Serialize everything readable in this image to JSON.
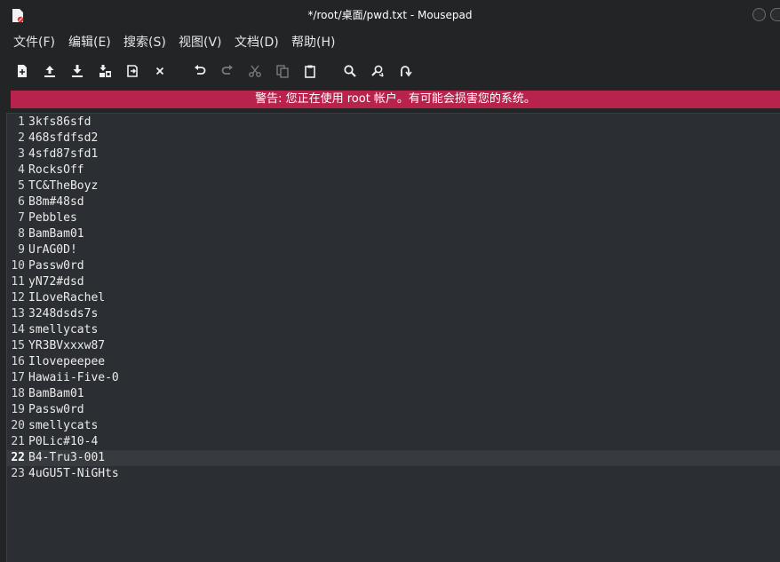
{
  "window": {
    "title": "*/root/桌面/pwd.txt - Mousepad"
  },
  "menu": [
    {
      "label": "文件(F)"
    },
    {
      "label": "编辑(E)"
    },
    {
      "label": "搜索(S)"
    },
    {
      "label": "视图(V)"
    },
    {
      "label": "文档(D)"
    },
    {
      "label": "帮助(H)"
    }
  ],
  "toolbar": [
    {
      "icon": "new-document-icon"
    },
    {
      "icon": "open-icon"
    },
    {
      "icon": "save-icon"
    },
    {
      "icon": "save-as-icon"
    },
    {
      "icon": "reload-icon"
    },
    {
      "icon": "close-icon"
    },
    {
      "icon": "undo-icon"
    },
    {
      "icon": "redo-icon"
    },
    {
      "icon": "cut-icon"
    },
    {
      "icon": "copy-icon"
    },
    {
      "icon": "paste-icon"
    },
    {
      "icon": "find-icon"
    },
    {
      "icon": "find-replace-icon"
    },
    {
      "icon": "go-to-line-icon"
    }
  ],
  "warning": {
    "text": "警告: 您正在使用 root 帐户。有可能会损害您的系统。",
    "color": "#b8234d"
  },
  "editor": {
    "current_line": 22,
    "lines": [
      {
        "n": "1",
        "text": "3kfs86sfd"
      },
      {
        "n": "2",
        "text": "468sfdfsd2"
      },
      {
        "n": "3",
        "text": "4sfd87sfd1"
      },
      {
        "n": "4",
        "text": "RocksOff"
      },
      {
        "n": "5",
        "text": "TC&TheBoyz"
      },
      {
        "n": "6",
        "text": "B8m#48sd"
      },
      {
        "n": "7",
        "text": "Pebbles"
      },
      {
        "n": "8",
        "text": "BamBam01"
      },
      {
        "n": "9",
        "text": "UrAG0D!"
      },
      {
        "n": "10",
        "text": "Passw0rd"
      },
      {
        "n": "11",
        "text": "yN72#dsd"
      },
      {
        "n": "12",
        "text": "ILoveRachel"
      },
      {
        "n": "13",
        "text": "3248dsds7s"
      },
      {
        "n": "14",
        "text": "smellycats"
      },
      {
        "n": "15",
        "text": "YR3BVxxxw87"
      },
      {
        "n": "16",
        "text": "Ilovepeepee"
      },
      {
        "n": "17",
        "text": "Hawaii-Five-0"
      },
      {
        "n": "18",
        "text": "BamBam01"
      },
      {
        "n": "19",
        "text": "Passw0rd"
      },
      {
        "n": "20",
        "text": "smellycats"
      },
      {
        "n": "21",
        "text": "P0Lic#10-4"
      },
      {
        "n": "22",
        "text": "B4-Tru3-001"
      },
      {
        "n": "23",
        "text": "4uGU5T-NiGHts"
      }
    ]
  }
}
